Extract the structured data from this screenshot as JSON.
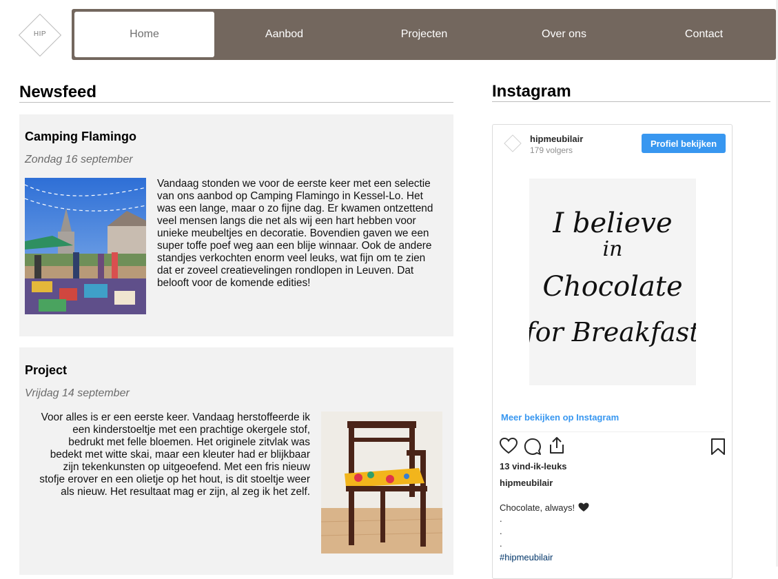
{
  "logo": {
    "text": "HIP"
  },
  "nav": {
    "items": [
      {
        "label": "Home"
      },
      {
        "label": "Aanbod"
      },
      {
        "label": "Projecten"
      },
      {
        "label": "Over ons"
      },
      {
        "label": "Contact"
      }
    ],
    "active_index": 0
  },
  "newsfeed": {
    "title": "Newsfeed",
    "posts": [
      {
        "title": "Camping Flamingo",
        "date": "Zondag 16 september",
        "lines": [
          "Vandaag stonden we voor de eerste keer met een selectie",
          "van ons aanbod op Camping Flamingo in Kessel-Lo. Het",
          "was een lange, maar o zo fijne dag. Er kwamen ontzettend",
          "veel mensen langs die net als wij een hart hebben voor",
          "unieke meubeltjes en decoratie. Bovendien gaven we een",
          "super toffe poef weg aan een blije winnaar. Ook de andere",
          "standjes verkochten enorm veel leuks, wat fijn om te zien",
          "dat er zoveel creatievelingen rondlopen in Leuven. Dat",
          "belooft voor de komende edities!"
        ]
      },
      {
        "title": "Project",
        "date": "Vrijdag 14 september",
        "lines": [
          "Voor alles is er een eerste keer. Vandaag herstoffeerde ik",
          "een kinderstoeltje met een prachtige okergele stof,",
          "bedrukt met felle bloemen. Het originele zitvlak was",
          "bedekt met witte skai, maar een kleuter had er blijkbaar",
          "zijn tekenkunsten op uitgeoefend. Met een fris nieuw",
          "stofje erover en een olietje op het hout, is dit stoeltje weer",
          "als nieuw. Het resultaat mag er zijn, al zeg ik het zelf."
        ]
      }
    ]
  },
  "instagram": {
    "title": "Instagram",
    "username": "hipmeubilair",
    "followers": "179 volgers",
    "profile_button": "Profiel bekijken",
    "image_text": [
      "I believe",
      "in",
      "Chocolate",
      "for Breakfast"
    ],
    "more_link": "Meer bekijken op Instagram",
    "likes": "13 vind-ik-leuks",
    "author": "hipmeubilair",
    "caption": "Chocolate, always!",
    "caption_icon": "black-heart-icon",
    "dots": [
      ".",
      ".",
      "."
    ],
    "hashtag": "#hipmeubilair"
  }
}
